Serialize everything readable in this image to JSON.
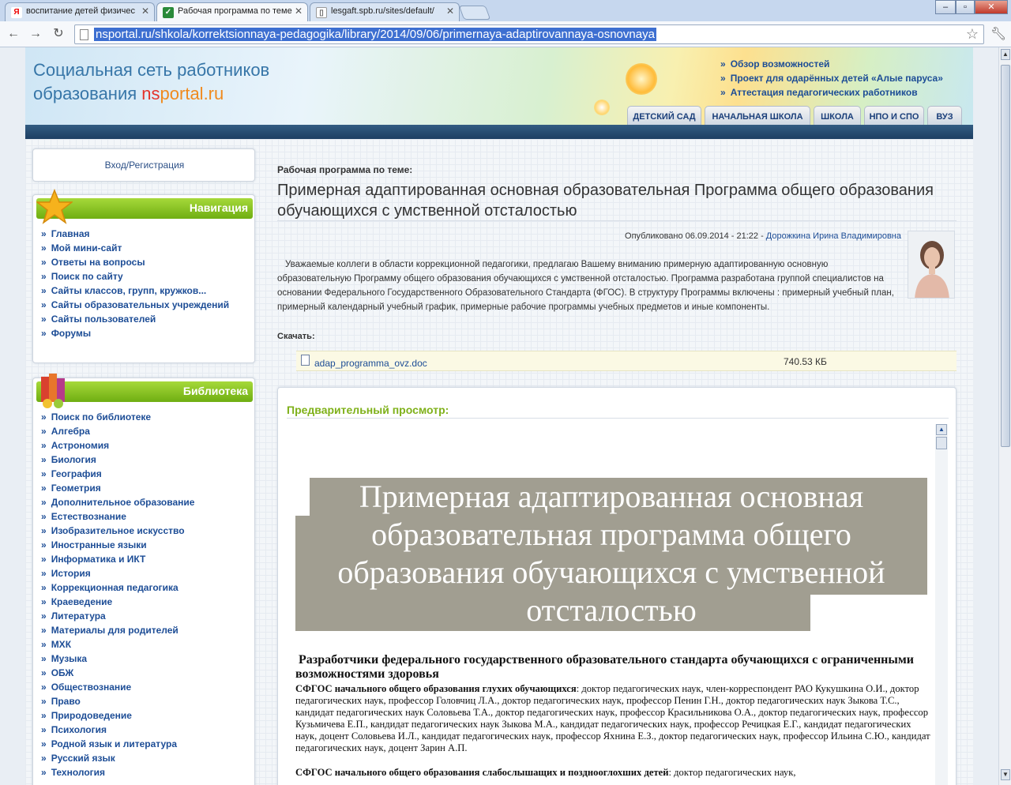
{
  "browser": {
    "tabs": [
      {
        "label": "воспитание детей физичес",
        "favicon": "Я",
        "active": false
      },
      {
        "label": "Рабочая программа по теме",
        "favicon": "✓",
        "active": true
      },
      {
        "label": "lesgaft.spb.ru/sites/default/",
        "favicon": "▯",
        "active": false
      }
    ],
    "url": "nsportal.ru/shkola/korrektsionnaya-pedagogika/library/2014/09/06/primernaya-adaptirovannaya-osnovnaya",
    "window_controls": [
      "–",
      "▫",
      "✕"
    ]
  },
  "header": {
    "title_line1": "Социальная сеть работников",
    "title_line2_prefix": "образования ",
    "brand_ns": "ns",
    "brand_rest": "portal.ru",
    "links": [
      "Обзор возможностей",
      "Проект для одарённых детей «Алые паруса»",
      "Аттестация педагогических работников"
    ],
    "tabs": [
      "ДЕТСКИЙ САД",
      "НАЧАЛЬНАЯ ШКОЛА",
      "ШКОЛА",
      "НПО И СПО",
      "ВУЗ"
    ],
    "bullet": "»"
  },
  "sidebar": {
    "login": "Вход/Регистрация",
    "nav_title": "Навигация",
    "nav_items": [
      "Главная",
      "Мой мини-сайт",
      "Ответы на вопросы",
      "Поиск по сайту",
      "Сайты классов, групп, кружков...",
      "Сайты образовательных учреждений",
      "Сайты пользователей",
      "Форумы"
    ],
    "lib_title": "Библиотека",
    "lib_items": [
      "Поиск по библиотеке",
      "Алгебра",
      "Астрономия",
      "Биология",
      "География",
      "Геометрия",
      "Дополнительное образование",
      "Естествознание",
      "Изобразительное искусство",
      "Иностранные языки",
      "Информатика и ИКТ",
      "История",
      "Коррекционная педагогика",
      "Краеведение",
      "Литература",
      "Материалы для родителей",
      "МХК",
      "Музыка",
      "ОБЖ",
      "Обществознание",
      "Право",
      "Природоведение",
      "Психология",
      "Родной язык и литература",
      "Русский язык",
      "Технология"
    ]
  },
  "content": {
    "kicker": "Рабочая программа по теме:",
    "title": "Примерная адаптированная основная образовательная Программа общего образования обучающихся с умственной отсталостью",
    "published_prefix": "Опубликовано 06.09.2014 - 21:22 - ",
    "author": "Дорожкина Ирина Владимировна",
    "description": "Уважаемые коллеги в области коррекционной педагогики, предлагаю Вашему вниманию примерную адаптированную основную образовательную Программу общего образования обучающихся с умственной отсталостью. Программа разработана группой специалистов на основании Федерального Государственного Образовательного Стандарта (ФГОС). В структуру Программы включены : примерный учебный план, примерный календарный учебный график, примерные рабочие программы учебных предметов и иные компоненты.",
    "download_label": "Скачать:",
    "file_name": "adap_programma_ovz.doc",
    "file_size": "740.53 КБ",
    "preview_label": "Предварительный просмотр:"
  },
  "preview_doc": {
    "big_title": "Примерная адаптированная основная образовательная программа общего образования обучающихся с умственной отсталостью",
    "dev_heading": "Разработчики федерального государственного образовательного стандарта обучающихся с ограниченными возможностями здоровья",
    "para1_bold": "СФГОС начального общего образования глухих обучающихся",
    "para1_text": ": доктор педагогических наук, член-корреспондент РАО Кукушкина О.И., доктор педагогических наук, профессор Головчиц Л.А., доктор педагогических наук, профессор Пенин Г.Н., доктор педагогических наук Зыкова Т.С., кандидат педагогических наук Соловьева Т.А., доктор педагогических наук, профессор Красильникова О.А., доктор педагогических наук, профессор Кузьмичева Е.П., кандидат педагогических наук Зыкова М.А., кандидат педагогических наук, профессор Речицкая Е.Г., кандидат педагогических наук, доцент Соловьева И.Л., кандидат педагогических наук, профессор Яхнина Е.З., доктор педагогических наук, профессор Ильина С.Ю., кандидат педагогических наук, доцент Зарин А.П.",
    "para2_bold": "СФГОС начального общего образования слабослышащих и позднооглохших детей",
    "para2_text": ": доктор педагогических наук,"
  }
}
